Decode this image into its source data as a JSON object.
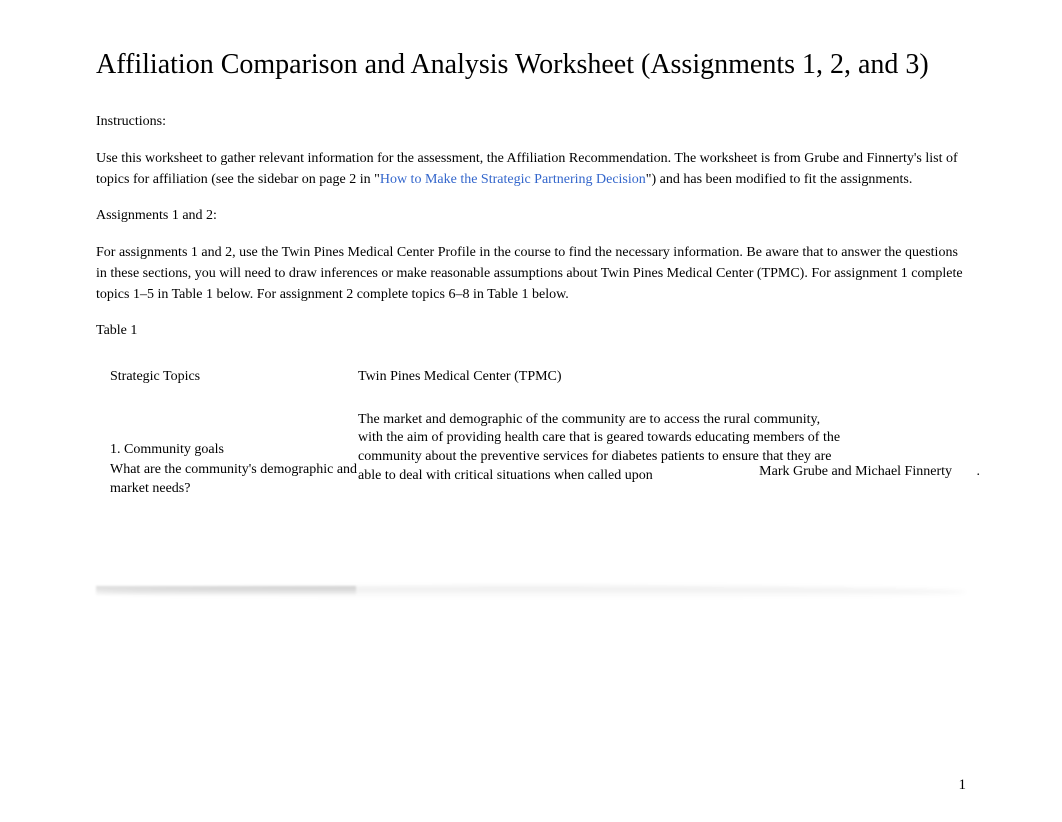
{
  "title": "Affiliation Comparison and Analysis Worksheet (Assignments 1, 2, and 3)",
  "instructions_label": "Instructions:",
  "intro_part1": "Use this worksheet to gather relevant information for the assessment, the Affiliation Recommendation. The worksheet is from Grube and Finnerty's list of topics for affiliation (see the sidebar on page 2 in \"",
  "intro_link": "How to Make the Strategic Partnering Decision",
  "intro_part2": "\") and has been modified to fit the assignments.",
  "assignments_label": "Assignments 1 and 2:",
  "assignments_text": "For assignments 1 and 2, use the Twin Pines Medical Center Profile in the course to find the necessary information. Be aware that to answer the questions in these sections, you will need to draw inferences or make reasonable assumptions about Twin Pines Medical Center (TPMC). For assignment 1 complete topics 1–5 in Table 1 below. For assignment 2 complete topics 6–8 in Table 1 below.",
  "table_label": "Table 1",
  "table": {
    "header_left": "Strategic Topics",
    "header_right": "Twin Pines Medical Center (TPMC)",
    "rows": [
      {
        "topic_number": "1. Community goals",
        "topic_question": "What are the community's demographic and market needs?",
        "answer_line1": "The market and demographic of the community are to access the rural community,",
        "answer_line2": "with the aim of providing health care that is geared towards educating members of the",
        "answer_line3": "community about the preventive services for diabetes patients to ensure that they are",
        "answer_line4": "able to deal with critical situations when called upon",
        "citation": "Mark Grube and Michael Finnerty",
        "citation_suffix": "."
      }
    ]
  },
  "page_number": "1"
}
